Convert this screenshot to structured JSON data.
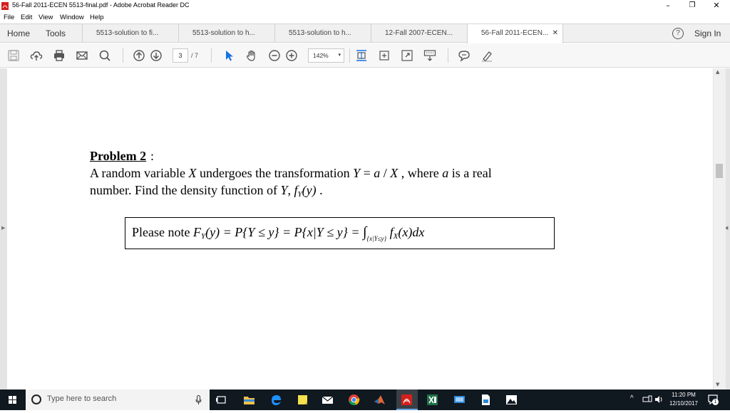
{
  "window": {
    "title": "56-Fall 2011-ECEN 5513-final.pdf - Adobe Acrobat Reader DC",
    "minimize": "–",
    "restore": "❐",
    "close": "✕"
  },
  "menu": [
    "File",
    "Edit",
    "View",
    "Window",
    "Help"
  ],
  "tabs": {
    "home": "Home",
    "tools": "Tools",
    "documents": [
      {
        "label": "5513-solution to fi...",
        "active": false
      },
      {
        "label": "5513-solution to h...",
        "active": false
      },
      {
        "label": "5513-solution to h...",
        "active": false
      },
      {
        "label": "12-Fall 2007-ECEN...",
        "active": false
      },
      {
        "label": "56-Fall 2011-ECEN...",
        "active": true
      }
    ],
    "close_glyph": "✕",
    "help": "?",
    "sign_in": "Sign In"
  },
  "toolbar": {
    "page_current": "3",
    "page_total": "/ 7",
    "zoom": "142%",
    "zoom_arrow": "▾"
  },
  "document": {
    "problem_title": "Problem 2",
    "problem_colon": ":",
    "line1_a": "A random variable ",
    "var_X": "X",
    "line1_b": " undergoes the transformation ",
    "eq_Y": "Y",
    "eq_eq": " = ",
    "eq_a": "a",
    "eq_slash": " / ",
    "eq_X": "X",
    "line1_c": " , where ",
    "var_a": "a",
    "line1_d": " is a real",
    "line2_a": "number. Find the density function of ",
    "var_Y": "Y",
    "line2_b": ",  ",
    "f": "f",
    "sub_Y": "Y",
    "arg_y": "(y)",
    "line2_c": " .",
    "note_prefix": "Please note ",
    "note_F": "F",
    "note_subY": "Y",
    "note_expr": "(y) = P{Y ≤ y} = P{x|Y ≤ y} = ",
    "integral": "∫",
    "int_sub": "{x|Y≤y}",
    "note_f": " f",
    "note_subX": "X",
    "note_tail": "(x)dx"
  },
  "taskbar": {
    "search_placeholder": "Type here to search",
    "time": "11:20 PM",
    "date": "12/10/2017",
    "tray_caret": "^",
    "notif_count": "1"
  },
  "colors": {
    "taskbar": "#101820",
    "acrobat_red": "#d4201c",
    "accent_blue": "#1473e6"
  }
}
